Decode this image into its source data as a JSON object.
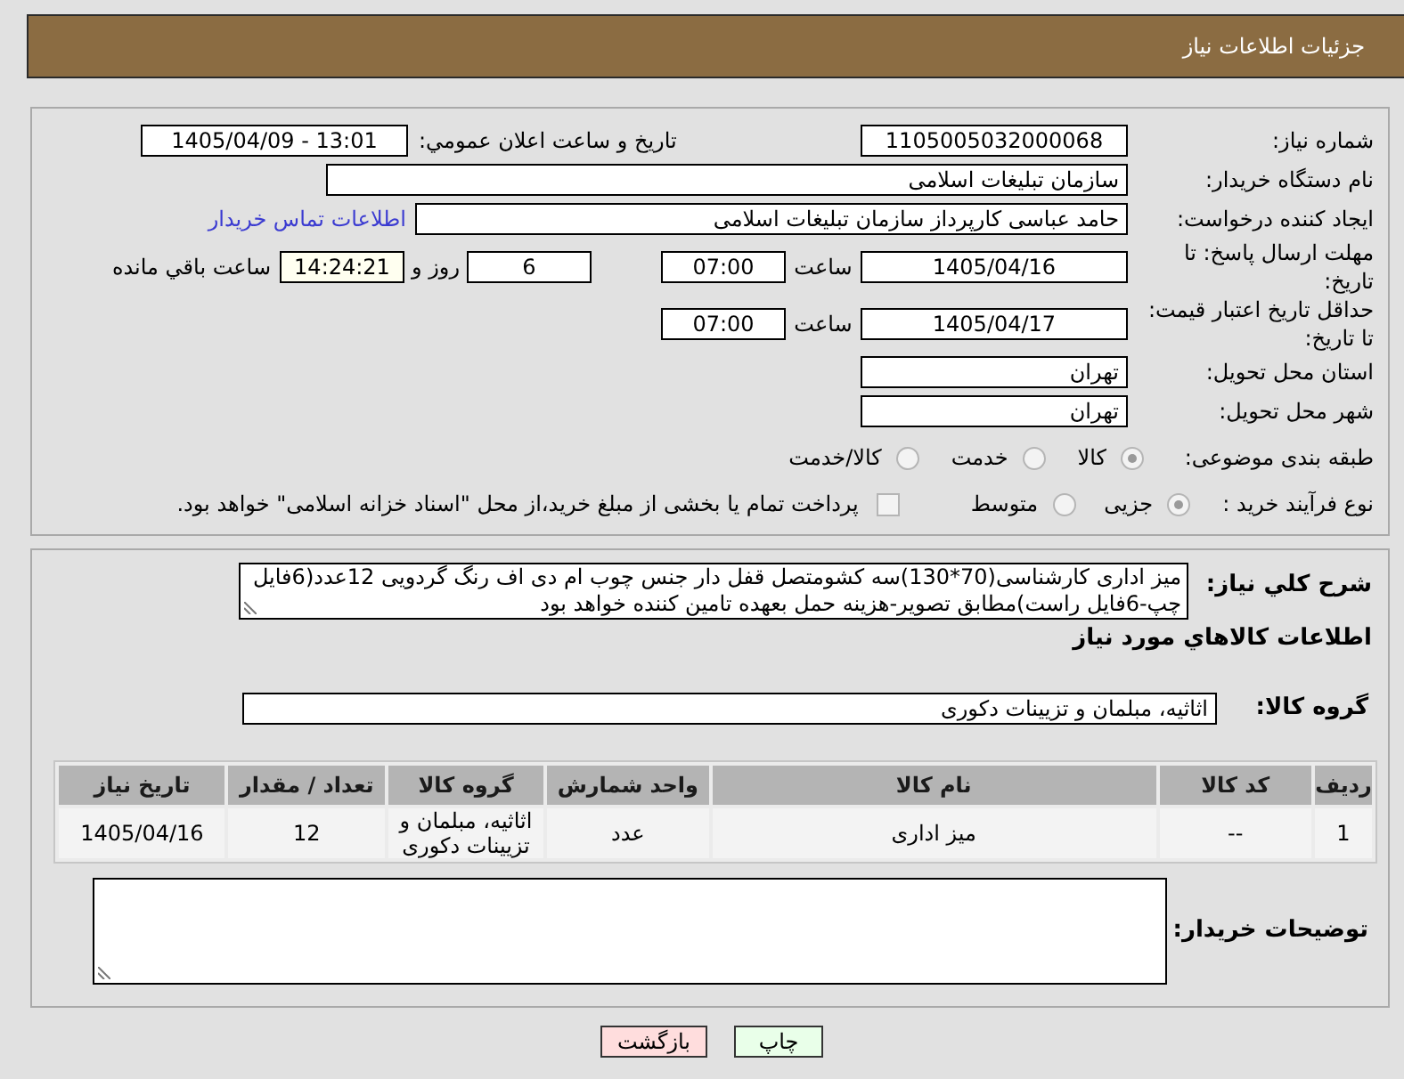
{
  "header": {
    "title": "جزئیات اطلاعات نیاز"
  },
  "need_number": {
    "label": "شماره نیاز:",
    "value": "1105005032000068"
  },
  "announcement": {
    "label": "تاریخ و ساعت اعلان عمومي:",
    "value": "1405/04/09 - 13:01"
  },
  "buyer_org": {
    "label": "نام دستگاه خریدار:",
    "value": "سازمان تبلیغات اسلامی"
  },
  "requester": {
    "label": "ایجاد کننده درخواست:",
    "value": "حامد عباسی کارپرداز سازمان تبلیغات اسلامی",
    "contact_link": "اطلاعات تماس خریدار"
  },
  "response_deadline": {
    "label": "مهلت ارسال پاسخ: تا تاریخ:",
    "date": "1405/04/16",
    "time_label": "ساعت",
    "time": "07:00",
    "days": "6",
    "days_label": "روز و",
    "remaining": "14:24:21",
    "remaining_label": "ساعت باقي مانده"
  },
  "price_validity": {
    "label": "حداقل تاریخ اعتبار قیمت: تا تاریخ:",
    "date": "1405/04/17",
    "time_label": "ساعت",
    "time": "07:00"
  },
  "delivery_province": {
    "label": "استان محل تحویل:",
    "value": "تهران"
  },
  "delivery_city": {
    "label": "شهر محل تحویل:",
    "value": "تهران"
  },
  "category": {
    "label": "طبقه بندی موضوعی:",
    "options": [
      {
        "label": "کالا",
        "selected": true
      },
      {
        "label": "خدمت",
        "selected": false
      },
      {
        "label": "کالا/خدمت",
        "selected": false
      }
    ]
  },
  "purchase_process": {
    "label": "نوع فرآیند خرید :",
    "options": [
      {
        "label": "جزیی",
        "selected": true
      },
      {
        "label": "متوسط",
        "selected": false
      }
    ],
    "treasury_option": {
      "label": "پرداخت تمام یا بخشی از مبلغ خرید،از محل \"اسناد خزانه اسلامی\" خواهد بود.",
      "checked": false
    }
  },
  "description": {
    "label": "شرح کلي نیاز:",
    "value": "میز اداری کارشناسی(70*130)سه کشومتصل قفل دار جنس چوب ام دی اف رنگ گردویی 12عدد(6فایل چپ-6فایل راست)مطابق تصویر-هزینه حمل بعهده تامین کننده خواهد بود"
  },
  "goods": {
    "title": "اطلاعات کالاهاي مورد نیاز",
    "group_label": "گروه کالا:",
    "group_value": "اثاثیه، مبلمان و تزیینات دکوری",
    "table": {
      "columns": [
        "ردیف",
        "کد کالا",
        "نام کالا",
        "واحد شمارش",
        "گروه کالا",
        "تعداد / مقدار",
        "تاریخ نیاز"
      ],
      "rows": [
        [
          "1",
          "--",
          "میز اداری",
          "عدد",
          "اثاثیه، مبلمان و تزیینات دکوری",
          "12",
          "1405/04/16"
        ]
      ]
    }
  },
  "buyer_notes": {
    "label": "توضیحات خریدار:"
  },
  "buttons": [
    {
      "kind": "print",
      "label": "چاپ"
    },
    {
      "kind": "back",
      "label": "بازگشت"
    }
  ]
}
